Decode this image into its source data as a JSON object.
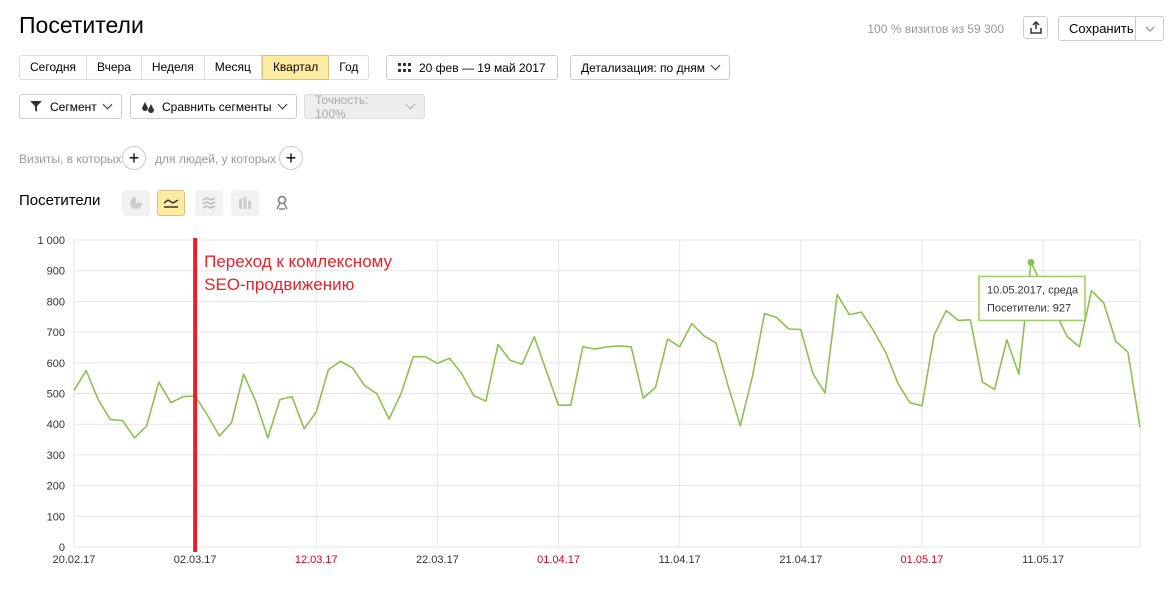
{
  "page": {
    "title": "Посетители",
    "visits_info": "100 % визитов из 59 300",
    "save_label": "Сохранить"
  },
  "period": {
    "buttons": [
      "Сегодня",
      "Вчера",
      "Неделя",
      "Месяц",
      "Квартал",
      "Год"
    ],
    "active": "Квартал",
    "date_range": "20 фев — 19 май 2017",
    "detail": "Детализация: по дням"
  },
  "segments": {
    "segment_label": "Сегмент",
    "compare_label": "Сравнить сегменты",
    "accuracy_label": "Точность: 100%"
  },
  "conditions": {
    "visits_label": "Визиты, в которых",
    "people_label": "для людей, у которых"
  },
  "chart_section": {
    "title": "Посетители",
    "icons": [
      "pie-chart-icon",
      "line-chart-icon",
      "area-chart-icon",
      "bar-chart-icon",
      "map-pin-icon"
    ],
    "active_icon": "line-chart-icon"
  },
  "chart_data": {
    "type": "line",
    "ylim": [
      0,
      1000
    ],
    "y_ticks": [
      "0",
      "100",
      "200",
      "300",
      "400",
      "500",
      "600",
      "700",
      "800",
      "900",
      "1 000"
    ],
    "x_start": "2017-02-20",
    "x_ticks": [
      {
        "label": "20.02.17",
        "day": 0,
        "red": false
      },
      {
        "label": "02.03.17",
        "day": 10,
        "red": false
      },
      {
        "label": "12.03.17",
        "day": 20,
        "red": true
      },
      {
        "label": "22.03.17",
        "day": 30,
        "red": false
      },
      {
        "label": "01.04.17",
        "day": 40,
        "red": true
      },
      {
        "label": "11.04.17",
        "day": 50,
        "red": false
      },
      {
        "label": "21.04.17",
        "day": 60,
        "red": false
      },
      {
        "label": "01.05.17",
        "day": 70,
        "red": true
      },
      {
        "label": "11.05.17",
        "day": 80,
        "red": false
      }
    ],
    "series": [
      {
        "color": "#8cc152",
        "values": [
          510,
          575,
          480,
          415,
          412,
          355,
          395,
          537,
          470,
          490,
          492,
          430,
          362,
          405,
          563,
          475,
          355,
          480,
          490,
          385,
          440,
          578,
          605,
          583,
          525,
          500,
          417,
          500,
          620,
          620,
          598,
          615,
          565,
          493,
          475,
          660,
          608,
          595,
          685,
          573,
          462,
          462,
          652,
          645,
          652,
          655,
          652,
          485,
          520,
          678,
          652,
          728,
          688,
          665,
          525,
          395,
          555,
          760,
          748,
          710,
          708,
          565,
          502,
          822,
          757,
          765,
          705,
          635,
          535,
          470,
          460,
          690,
          770,
          738,
          740,
          537,
          513,
          675,
          563,
          927,
          845,
          765,
          685,
          652,
          835,
          795,
          670,
          635,
          390
        ]
      }
    ],
    "annotation": {
      "text_line1": "Переход к комлексному",
      "text_line2": "SEO-продвижению",
      "day": 10,
      "color": "#e8202a"
    },
    "tooltip": {
      "date": "10.05.2017, среда",
      "value_label": "Посетители: 927",
      "day": 79,
      "value": 927
    }
  }
}
